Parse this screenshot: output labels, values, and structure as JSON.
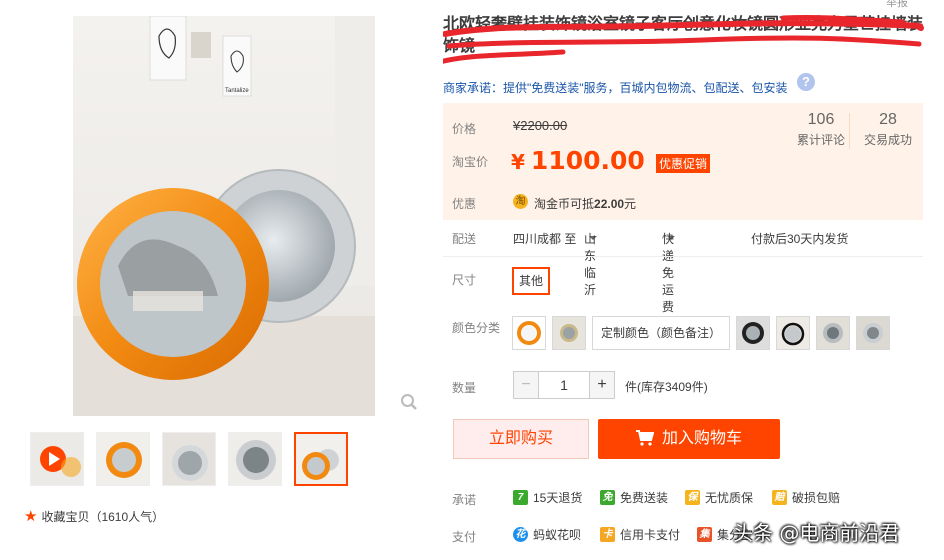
{
  "header": {
    "report_link": "举报",
    "title": "北欧轻奢壁挂装饰镜浴室镜子客厅创意化妆镜圆形亚克力星芒挂墙装饰镜"
  },
  "gallery": {
    "poster_text": "Tantalize",
    "thumbnails": [
      {
        "name": "video"
      },
      {
        "name": "orange-mirror"
      },
      {
        "name": "gray-mirror"
      },
      {
        "name": "mirror-detail"
      },
      {
        "name": "orange-and-gray-mirrors"
      }
    ],
    "favorite_label": "收藏宝贝（1610人气）"
  },
  "promise": "商家承诺：提供\"免费送装\"服务，百城内包物流、包配送、包安装",
  "price": {
    "original_label": "价格",
    "original_value": "¥2200.00",
    "taobao_label": "淘宝价",
    "currency": "¥",
    "current_value": "1100.00",
    "promo_tag": "优惠促销"
  },
  "stats": {
    "reviews_count": "106",
    "reviews_label": "累计评论",
    "sales_count": "28",
    "sales_label": "交易成功"
  },
  "discount": {
    "label": "优惠",
    "coin_icon": "淘",
    "text_prefix": "淘金币可抵",
    "amount": "22.00",
    "text_suffix": "元"
  },
  "shipping": {
    "label": "配送",
    "from": "四川成都 至",
    "to": "山东临沂",
    "method": "快递 免运费",
    "time": "付款后30天内发货"
  },
  "size": {
    "label": "尺寸",
    "option": "其他"
  },
  "colors": {
    "label": "颜色分类",
    "custom_option": "定制颜色（颜色备注）"
  },
  "quantity": {
    "label": "数量",
    "value": "1",
    "minus": "−",
    "plus": "+",
    "stock": "件(库存3409件)"
  },
  "actions": {
    "buy_now": "立即购买",
    "add_to_cart": "加入购物车"
  },
  "services": {
    "label": "承诺",
    "items": [
      {
        "icon": "7",
        "text": "15天退货",
        "color": "#3ba92e"
      },
      {
        "icon": "免",
        "text": "免费送装",
        "color": "#3ba92e"
      },
      {
        "icon": "保",
        "text": "无忧质保",
        "color": "#f5b41e"
      },
      {
        "icon": "赔",
        "text": "破损包赔",
        "color": "#f5b41e"
      }
    ]
  },
  "payment": {
    "label": "支付",
    "items": [
      {
        "icon": "花",
        "text": "蚂蚁花呗",
        "color": "#1e8fea"
      },
      {
        "icon": "卡",
        "text": "信用卡支付",
        "color": "#f5a623"
      },
      {
        "icon": "集",
        "text": "集分宝",
        "color": "#e8542a"
      }
    ]
  },
  "watermark": "头条 @电商前沿君"
}
